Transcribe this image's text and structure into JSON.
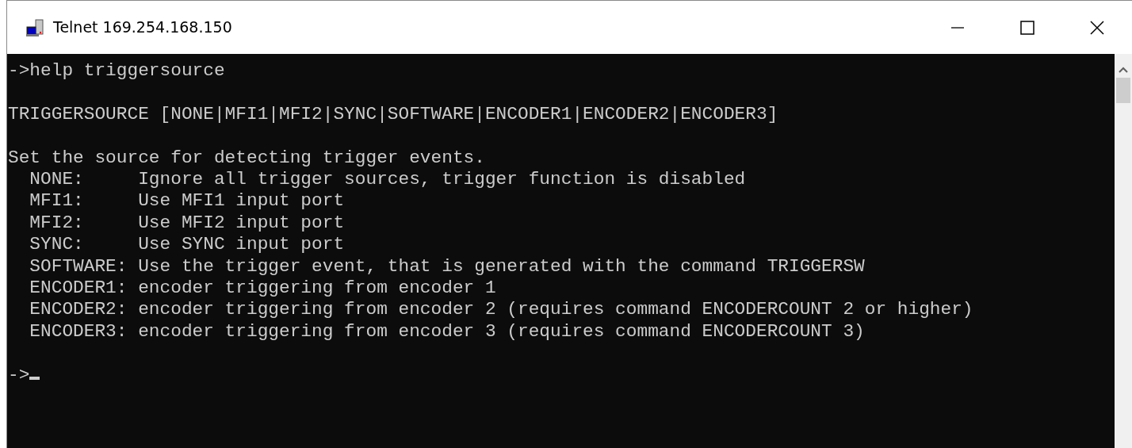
{
  "window": {
    "title": "Telnet 169.254.168.150"
  },
  "terminal": {
    "blocks": [
      {
        "lines": [
          "->help triggersource"
        ]
      },
      {
        "lines": [
          "TRIGGERSOURCE [NONE|MFI1|MFI2|SYNC|SOFTWARE|ENCODER1|ENCODER2|ENCODER3]"
        ]
      },
      {
        "lines": [
          "Set the source for detecting trigger events.",
          "  NONE:     Ignore all trigger sources, trigger function is disabled",
          "  MFI1:     Use MFI1 input port",
          "  MFI2:     Use MFI2 input port",
          "  SYNC:     Use SYNC input port",
          "  SOFTWARE: Use the trigger event, that is generated with the command TRIGGERSW",
          "  ENCODER1: encoder triggering from encoder 1",
          "  ENCODER2: encoder triggering from encoder 2 (requires command ENCODERCOUNT 2 or higher)",
          "  ENCODER3: encoder triggering from encoder 3 (requires command ENCODERCOUNT 3)"
        ]
      },
      {
        "lines": [
          "->"
        ],
        "cursor": true
      }
    ]
  }
}
